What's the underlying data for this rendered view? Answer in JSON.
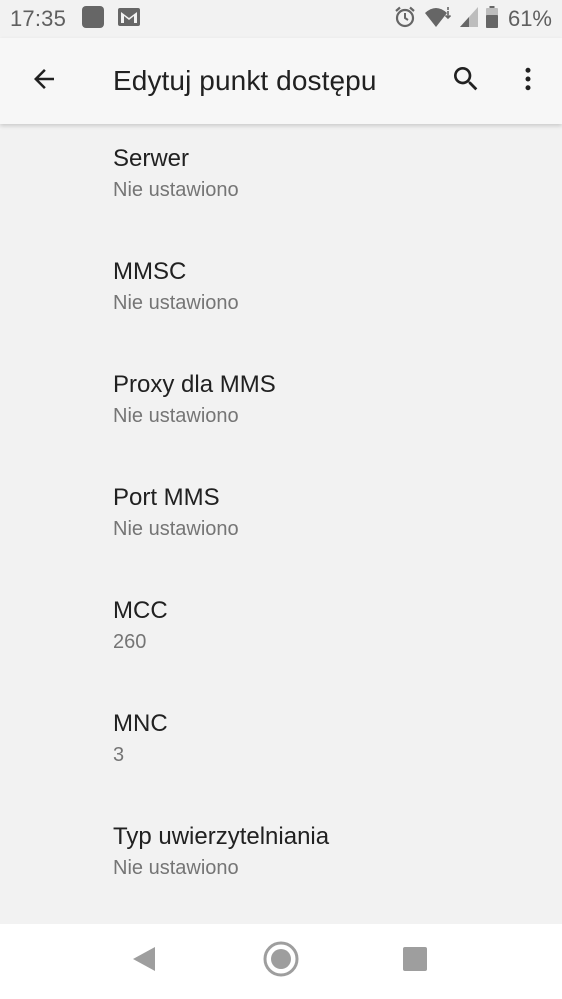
{
  "status_bar": {
    "time": "17:35",
    "left_icons": [
      "app-square-icon",
      "gmail-icon"
    ],
    "right_icons": [
      "alarm-icon",
      "wifi-icon",
      "cell-signal-icon",
      "battery-icon"
    ],
    "battery_percent": "61%"
  },
  "app_bar": {
    "title": "Edytuj punkt dostępu",
    "back_icon": "arrow-back-icon",
    "search_icon": "search-icon",
    "more_icon": "more-vert-icon"
  },
  "settings": [
    {
      "title": "Serwer",
      "summary": "Nie ustawiono"
    },
    {
      "title": "MMSC",
      "summary": "Nie ustawiono"
    },
    {
      "title": "Proxy dla MMS",
      "summary": "Nie ustawiono"
    },
    {
      "title": "Port MMS",
      "summary": "Nie ustawiono"
    },
    {
      "title": "MCC",
      "summary": "260"
    },
    {
      "title": "MNC",
      "summary": "3"
    },
    {
      "title": "Typ uwierzytelniania",
      "summary": "Nie ustawiono"
    }
  ],
  "nav_bar": {
    "icons": [
      "back-triangle-icon",
      "home-circle-icon",
      "recents-square-icon"
    ]
  },
  "colors": {
    "background": "#f2f2f2",
    "app_bar": "#f7f7f7",
    "primary_text": "#212121",
    "secondary_text": "#757575",
    "nav_icons": "#9e9e9e"
  }
}
